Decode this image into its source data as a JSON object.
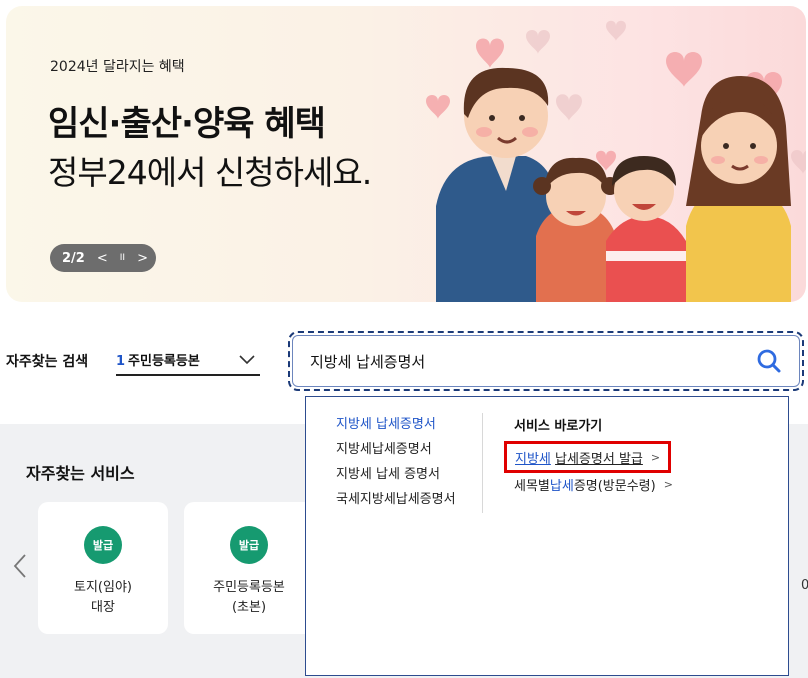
{
  "banner": {
    "subtitle": "2024년 달라지는 혜택",
    "title": "임신·출산·양육 혜택",
    "title2": "정부24에서 신청하세요.",
    "pager": {
      "count": "2/2",
      "prev": "<",
      "pause": "II",
      "next": ">"
    }
  },
  "frequent_search": {
    "label": "자주찾는 검색",
    "rank": "1",
    "selected": "주민등록등본"
  },
  "search": {
    "value": "지방세 납세증명서"
  },
  "dropdown": {
    "suggestions": [
      "지방세 납세증명서",
      "지방세납세증명서",
      "지방세 납세 증명서",
      "국세지방세납세증명서"
    ],
    "shortcuts_title": "서비스 바로가기",
    "shortcut1": {
      "highlight": "지방세",
      "rest": "납세증명서 발급",
      "arrow": ">"
    },
    "shortcut2": {
      "pre": "세목별",
      "highlight": "납세",
      "post": "증명(방문수령)",
      "arrow": ">"
    }
  },
  "services": {
    "title": "자주찾는 서비스",
    "cards": [
      {
        "badge": "발급",
        "name_line1": "토지(임야)",
        "name_line2": "대장"
      },
      {
        "badge": "발급",
        "name_line1": "주민등록등본",
        "name_line2": "(초본)"
      }
    ],
    "edge_text": "0"
  },
  "colors": {
    "accent_blue": "#1f55c8",
    "badge_green": "#169a70",
    "highlight_red": "#e00000"
  }
}
